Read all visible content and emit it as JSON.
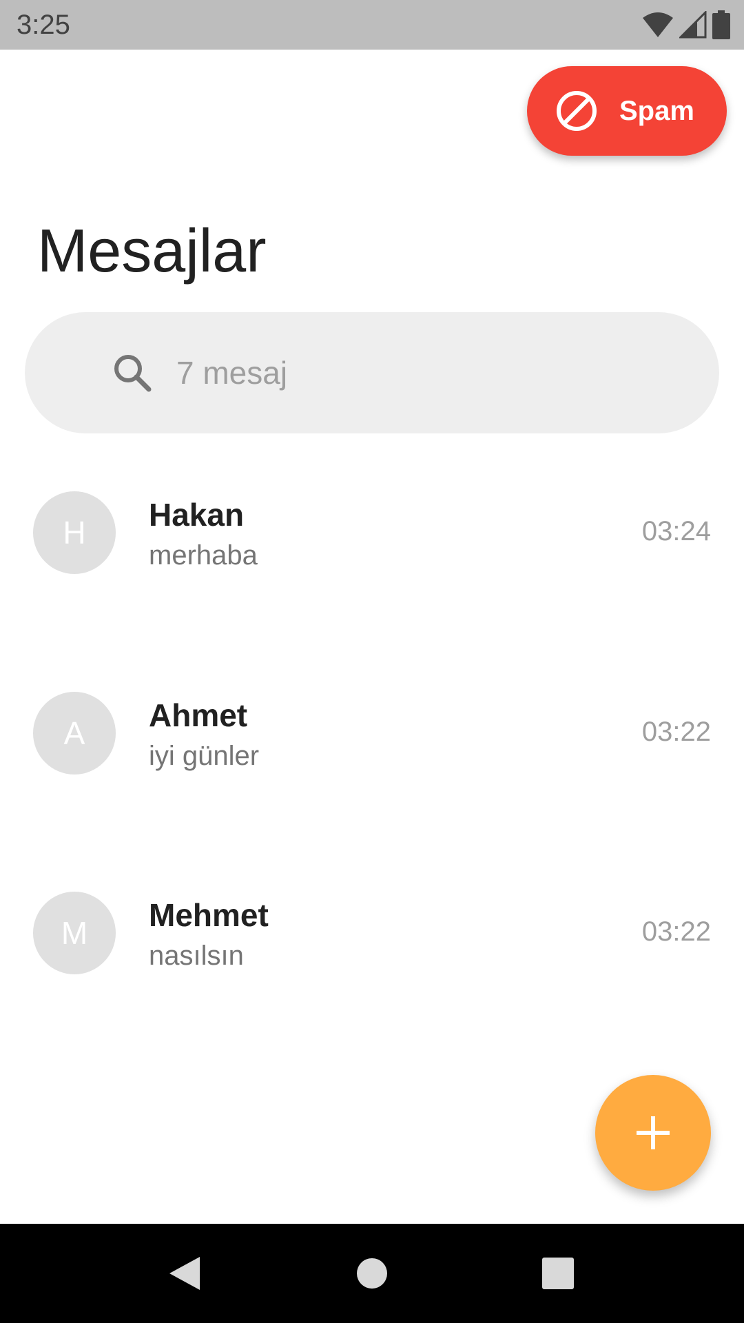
{
  "status_bar": {
    "time": "3:25",
    "icons": [
      "wifi-icon",
      "signal-icon",
      "battery-icon"
    ]
  },
  "spam_button": {
    "label": "Spam",
    "icon": "block-icon",
    "color": "#f44336"
  },
  "header": {
    "title": "Mesajlar"
  },
  "search": {
    "icon": "search-icon",
    "placeholder": "7 mesaj"
  },
  "conversations": [
    {
      "initial": "H",
      "name": "Hakan",
      "preview": "merhaba",
      "time": "03:24"
    },
    {
      "initial": "A",
      "name": "Ahmet",
      "preview": "iyi günler",
      "time": "03:22"
    },
    {
      "initial": "M",
      "name": "Mehmet",
      "preview": "nasılsın",
      "time": "03:22"
    }
  ],
  "fab": {
    "icon": "plus-icon",
    "color": "#ffab40"
  },
  "nav_bar": {
    "buttons": [
      "back-icon",
      "home-icon",
      "recents-icon"
    ]
  }
}
